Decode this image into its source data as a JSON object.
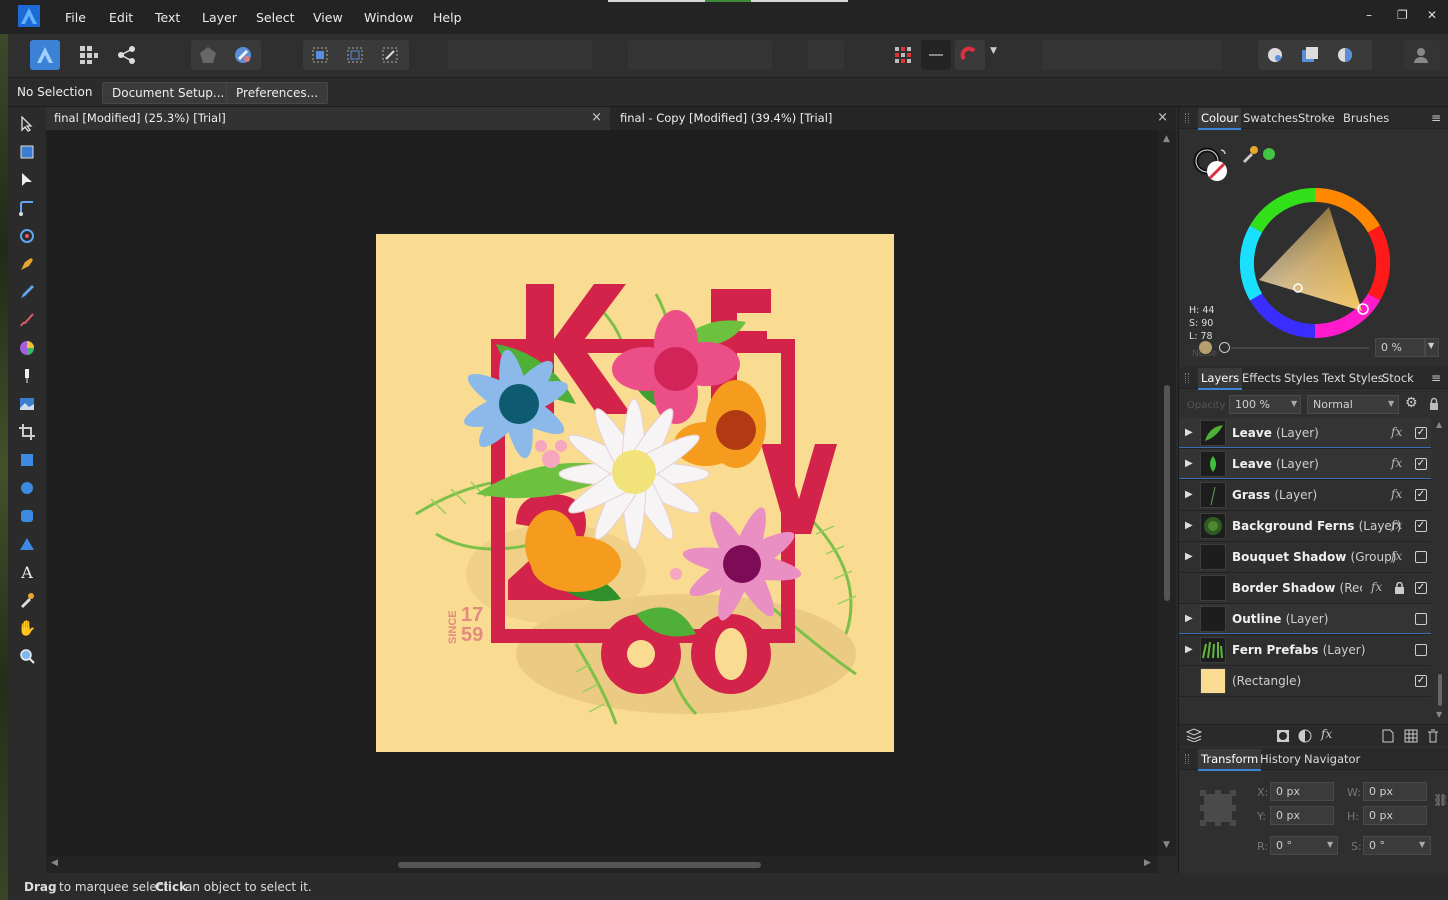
{
  "menubar": {
    "items": [
      "File",
      "Edit",
      "Text",
      "Layer",
      "Select",
      "View",
      "Window",
      "Help"
    ]
  },
  "context": {
    "selection_label": "No Selection",
    "document_setup": "Document Setup...",
    "preferences": "Preferences..."
  },
  "tabs": [
    {
      "label": "final [Modified] (25.3%) [Trial]"
    },
    {
      "label": "final - Copy [Modified] (39.4%) [Trial]"
    }
  ],
  "colour_panel": {
    "tabs": [
      "Colour",
      "Swatches",
      "Stroke",
      "Brushes"
    ],
    "h": "H: 44",
    "s": "S: 90",
    "l": "L: 78",
    "noise_label": "Noise",
    "noise_value": "0 %",
    "current_color": "#f7d77b"
  },
  "layers_panel": {
    "tabs": [
      "Layers",
      "Effects",
      "Styles",
      "Text Styles",
      "Stock"
    ],
    "opacity_label": "Opacity",
    "opacity": "100 %",
    "blend_mode": "Normal",
    "layers": [
      {
        "name": "Leave",
        "type": "(Layer)"
      },
      {
        "name": "Leave",
        "type": "(Layer)"
      },
      {
        "name": "Grass",
        "type": "(Layer)"
      },
      {
        "name": "Background Ferns",
        "type": "(Layer)"
      },
      {
        "name": "Bouquet Shadow",
        "type": "(Group)"
      },
      {
        "name": "Border Shadow",
        "type": "(Rect..."
      },
      {
        "name": "Outline",
        "type": "(Layer)"
      },
      {
        "name": "Fern Prefabs",
        "type": "(Layer)"
      },
      {
        "name": "",
        "type": "(Rectangle)"
      }
    ]
  },
  "transform_panel": {
    "tabs": [
      "Transform",
      "History",
      "Navigator"
    ],
    "x_label": "X:",
    "x": "0 px",
    "y_label": "Y:",
    "y": "0 px",
    "w_label": "W:",
    "w": "0 px",
    "h_label": "H:",
    "h": "0 px",
    "r_label": "R:",
    "r": "0 °",
    "s_label": "S:",
    "s": "0 °"
  },
  "artwork": {
    "since_label": "SINCE",
    "year_top": "17",
    "year_bottom": "59",
    "background_color": "#f9dc92",
    "accent_color": "#d4234a"
  },
  "status": {
    "drag": "Drag",
    "drag_text": "to marquee select.",
    "click": "Click",
    "click_text": "an object to select it."
  }
}
